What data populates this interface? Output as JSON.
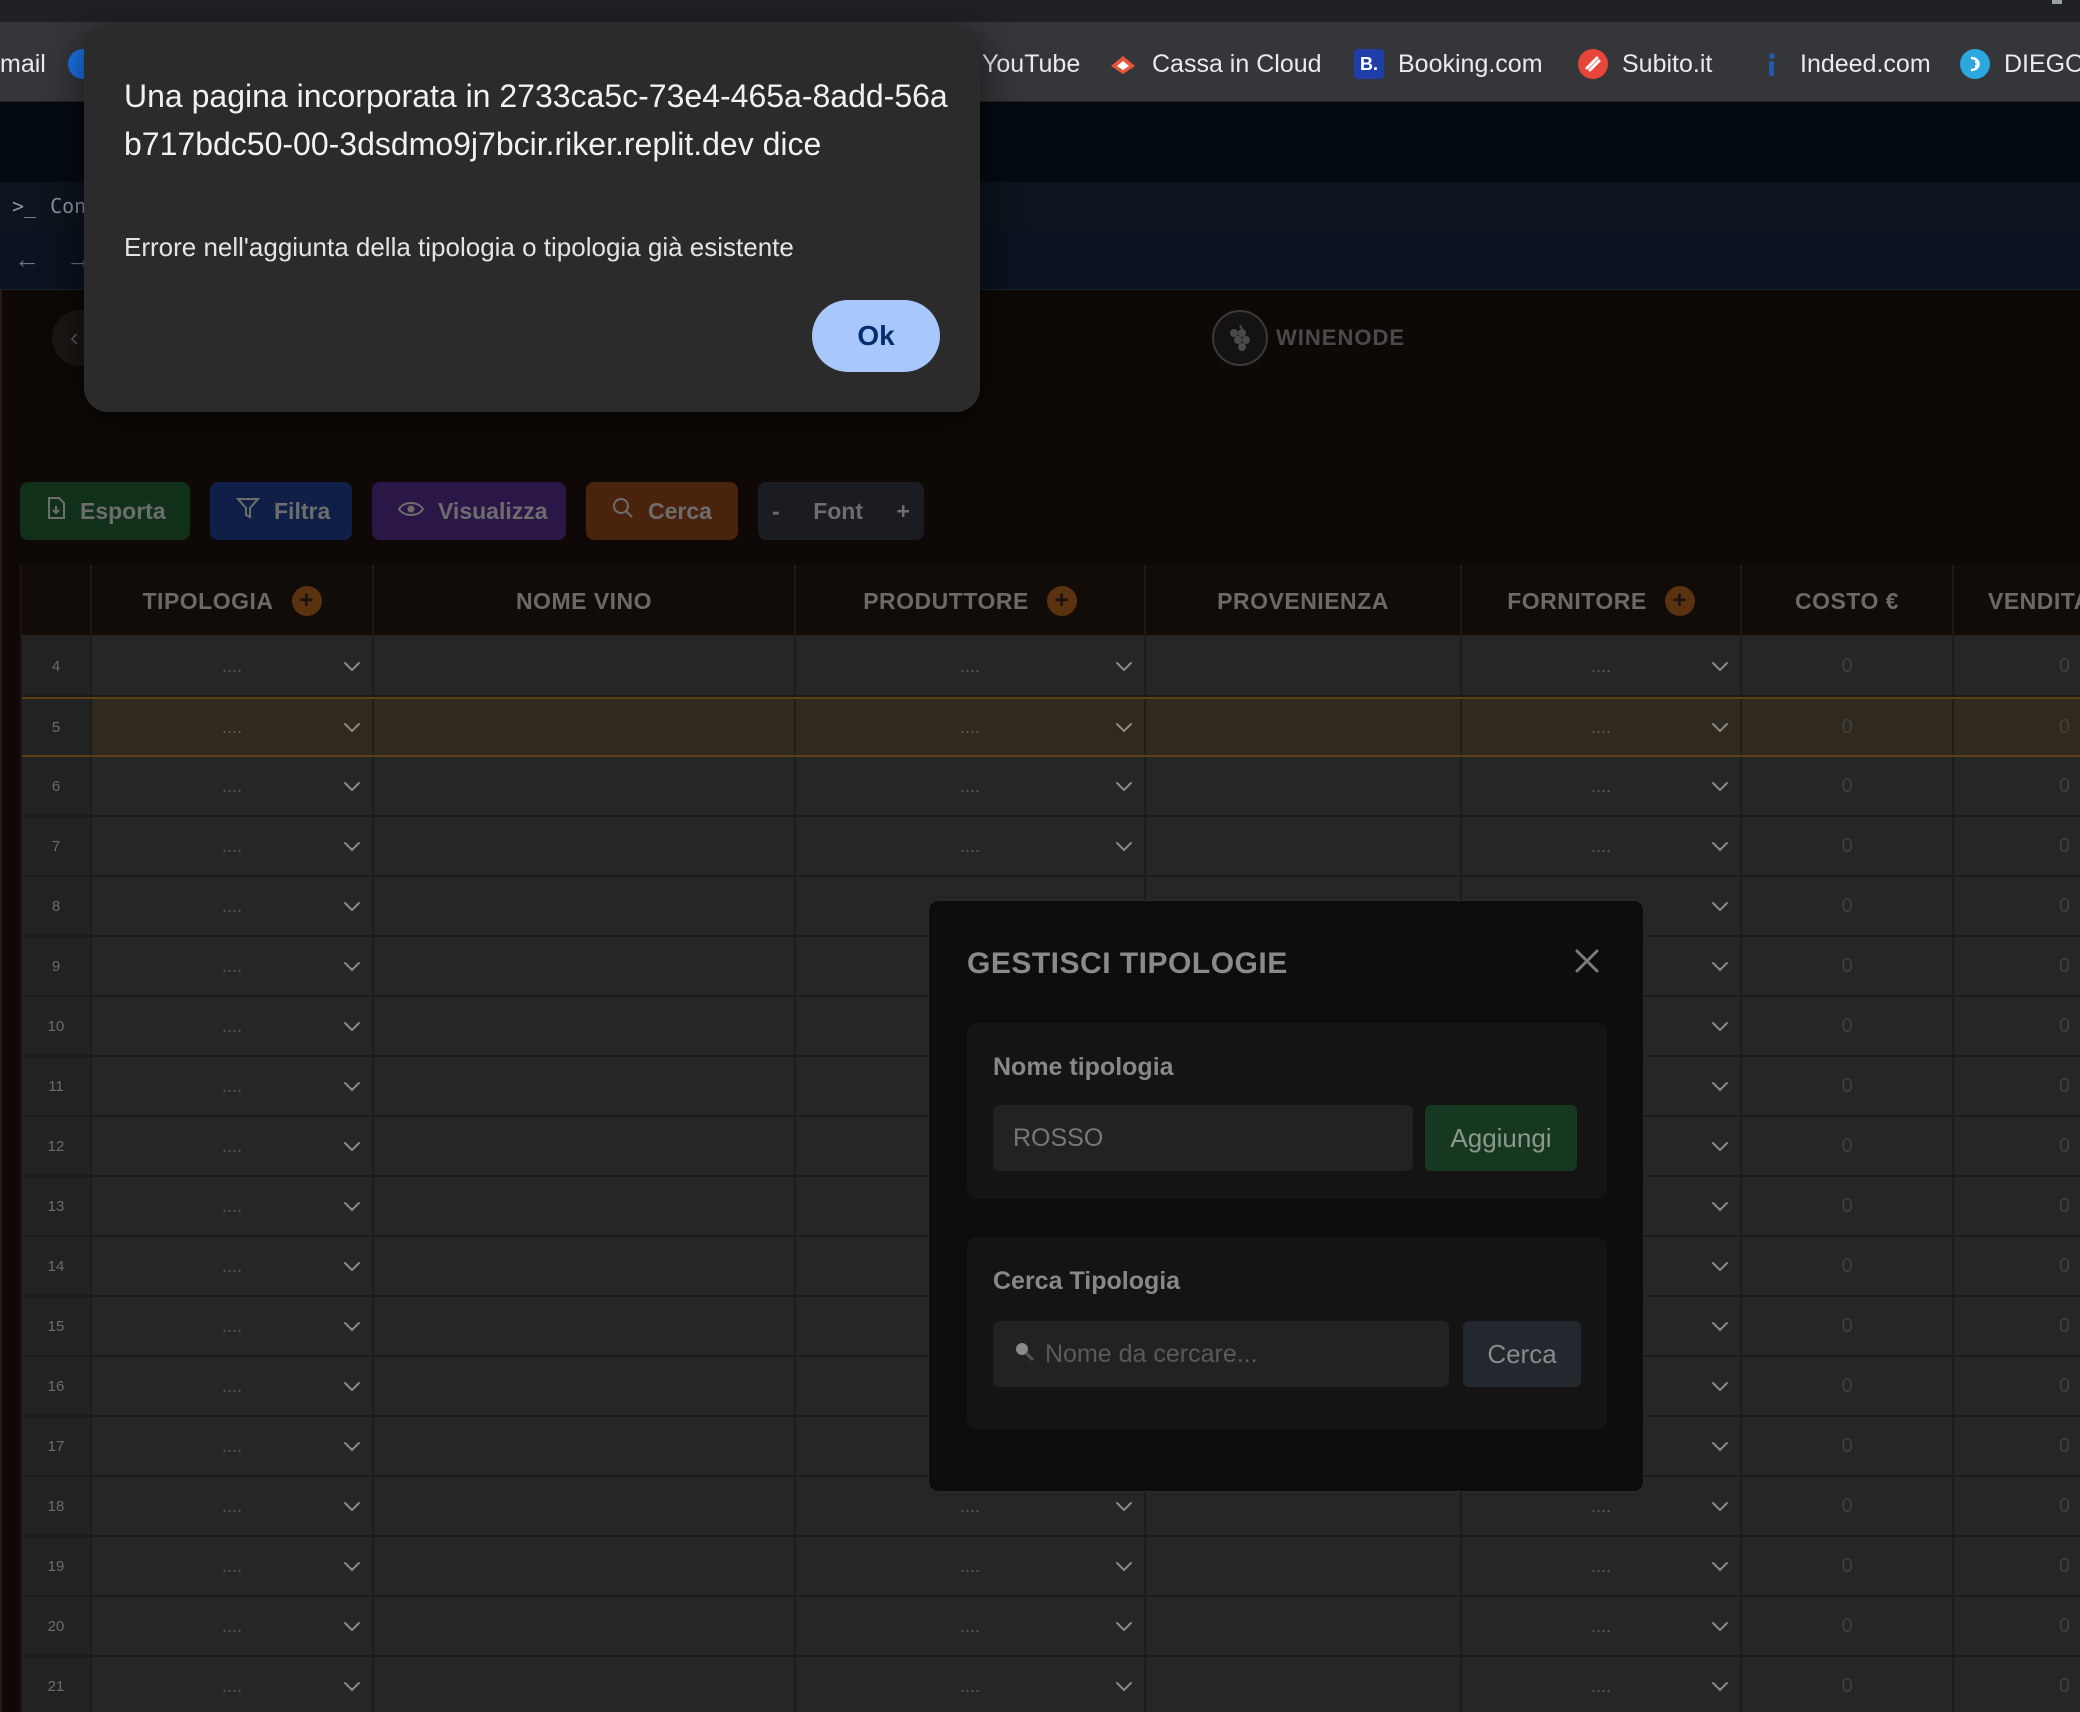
{
  "bookmarks": [
    {
      "label": "mail",
      "icon": "gmail-icon"
    },
    {
      "label": "YouTube",
      "icon": "youtube-icon"
    },
    {
      "label": "Cassa in Cloud",
      "icon": "cassa-in-cloud-icon"
    },
    {
      "label": "Booking.com",
      "icon": "booking-icon",
      "glyph": "B."
    },
    {
      "label": "Subito.it",
      "icon": "subito-icon"
    },
    {
      "label": "Indeed.com",
      "icon": "indeed-icon"
    },
    {
      "label": "DIEGO",
      "icon": "diego-icon"
    }
  ],
  "replit": {
    "tab_label": "Con"
  },
  "app": {
    "logo_text": "WINENODE",
    "actions": {
      "export": "Esporta",
      "filter": "Filtra",
      "view": "Visualizza",
      "search": "Cerca",
      "font_minus": "-",
      "font": "Font",
      "font_plus": "+"
    },
    "table": {
      "columns": [
        "TIPOLOGIA",
        "NOME VINO",
        "PRODUTTORE",
        "PROVENIENZA",
        "FORNITORE",
        "COSTO €",
        "VENDITA"
      ],
      "rows": [
        "4",
        "5",
        "6",
        "7",
        "8",
        "9",
        "10",
        "11",
        "12",
        "13",
        "14",
        "15",
        "16",
        "17",
        "18",
        "19",
        "20",
        "21"
      ],
      "placeholder": "....",
      "zero": "0"
    }
  },
  "modal": {
    "title": "GESTISCI TIPOLOGIE",
    "add_label": "Nome tipologia",
    "add_value": "ROSSO",
    "add_button": "Aggiungi",
    "search_label": "Cerca Tipologia",
    "search_placeholder": "Nome da cercare...",
    "search_button": "Cerca"
  },
  "alert": {
    "title": "Una pagina incorporata in 2733ca5c-73e4-465a-8add-56ab717bdc50-00-3dsdmo9j7bcir.riker.replit.dev dice",
    "message": "Errore nell'aggiunta della tipologia o tipologia già esistente",
    "ok": "Ok"
  },
  "colors": {
    "alert_bg": "#2b2b2c",
    "ok_button": "#a8c7fa",
    "add_button": "#173820"
  }
}
